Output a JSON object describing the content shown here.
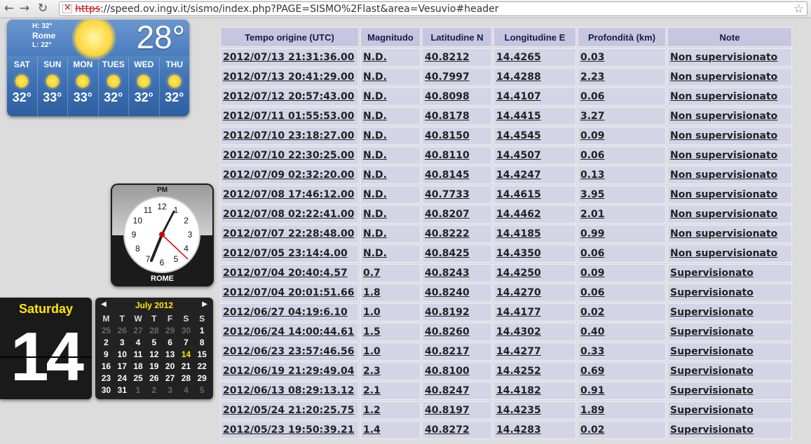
{
  "browser": {
    "url_scheme": "https",
    "url_rest": "://speed.ov.ingv.it/sismo/index.php?PAGE=SISMO%2Flast&area=Vesuvio#header"
  },
  "weather": {
    "hi": "H: 32°",
    "city": "Rome",
    "lo": "L: 22°",
    "current_temp": "28°",
    "days": [
      {
        "name": "SAT",
        "temp": "32°",
        "icon": "sun-icon"
      },
      {
        "name": "SUN",
        "temp": "33°",
        "icon": "sun-icon"
      },
      {
        "name": "MON",
        "temp": "33°",
        "icon": "sun-icon"
      },
      {
        "name": "TUES",
        "temp": "32°",
        "icon": "sun-icon"
      },
      {
        "name": "WED",
        "temp": "32°",
        "icon": "sun-icon"
      },
      {
        "name": "THU",
        "temp": "32°",
        "icon": "sun-icon"
      }
    ]
  },
  "clock": {
    "ampm": "PM",
    "city": "ROME",
    "numbers": [
      "12",
      "1",
      "2",
      "3",
      "4",
      "5",
      "6",
      "7",
      "8",
      "9",
      "10",
      "11"
    ]
  },
  "flip_calendar": {
    "weekday": "Saturday",
    "day": "14"
  },
  "month_calendar": {
    "title": "July 2012",
    "weekdays": [
      "M",
      "T",
      "W",
      "T",
      "F",
      "S",
      "S"
    ],
    "weeks": [
      [
        [
          "25",
          "dim"
        ],
        [
          "26",
          "dim"
        ],
        [
          "27",
          "dim"
        ],
        [
          "28",
          "dim"
        ],
        [
          "29",
          "dim"
        ],
        [
          "30",
          "dim"
        ],
        [
          "1",
          ""
        ]
      ],
      [
        [
          "2",
          ""
        ],
        [
          "3",
          ""
        ],
        [
          "4",
          ""
        ],
        [
          "5",
          ""
        ],
        [
          "6",
          ""
        ],
        [
          "7",
          ""
        ],
        [
          "8",
          ""
        ]
      ],
      [
        [
          "9",
          ""
        ],
        [
          "10",
          ""
        ],
        [
          "11",
          ""
        ],
        [
          "12",
          ""
        ],
        [
          "13",
          ""
        ],
        [
          "14",
          "today"
        ],
        [
          "15",
          ""
        ]
      ],
      [
        [
          "16",
          ""
        ],
        [
          "17",
          ""
        ],
        [
          "18",
          ""
        ],
        [
          "19",
          ""
        ],
        [
          "20",
          ""
        ],
        [
          "21",
          ""
        ],
        [
          "22",
          ""
        ]
      ],
      [
        [
          "23",
          ""
        ],
        [
          "24",
          ""
        ],
        [
          "25",
          ""
        ],
        [
          "26",
          ""
        ],
        [
          "27",
          ""
        ],
        [
          "28",
          ""
        ],
        [
          "29",
          ""
        ]
      ],
      [
        [
          "30",
          ""
        ],
        [
          "31",
          ""
        ],
        [
          "1",
          "dim"
        ],
        [
          "2",
          "dim"
        ],
        [
          "3",
          "dim"
        ],
        [
          "4",
          "dim"
        ],
        [
          "5",
          "dim"
        ]
      ]
    ]
  },
  "table": {
    "headers": [
      "Tempo origine (UTC)",
      "Magnitudo",
      "Latitudine N",
      "Longitudine E",
      "Profondità (km)",
      "Note"
    ],
    "rows": [
      [
        "2012/07/13 21:31:36.00",
        "N.D.",
        "40.8212",
        "14.4265",
        "0.03",
        "Non supervisionato"
      ],
      [
        "2012/07/13 20:41:29.00",
        "N.D.",
        "40.7997",
        "14.4288",
        "2.23",
        "Non supervisionato"
      ],
      [
        "2012/07/12 20:57:43.00",
        "N.D.",
        "40.8098",
        "14.4107",
        "0.06",
        "Non supervisionato"
      ],
      [
        "2012/07/11 01:55:53.00",
        "N.D.",
        "40.8178",
        "14.4415",
        "3.27",
        "Non supervisionato"
      ],
      [
        "2012/07/10 23:18:27.00",
        "N.D.",
        "40.8150",
        "14.4545",
        "0.09",
        "Non supervisionato"
      ],
      [
        "2012/07/10 22:30:25.00",
        "N.D.",
        "40.8110",
        "14.4507",
        "0.06",
        "Non supervisionato"
      ],
      [
        "2012/07/09 02:32:20.00",
        "N.D.",
        "40.8145",
        "14.4247",
        "0.13",
        "Non supervisionato"
      ],
      [
        "2012/07/08 17:46:12.00",
        "N.D.",
        "40.7733",
        "14.4615",
        "3.95",
        "Non supervisionato"
      ],
      [
        "2012/07/08 02:22:41.00",
        "N.D.",
        "40.8207",
        "14.4462",
        "2.01",
        "Non supervisionato"
      ],
      [
        "2012/07/07 22:28:48.00",
        "N.D.",
        "40.8222",
        "14.4185",
        "0.99",
        "Non supervisionato"
      ],
      [
        "2012/07/05 23:14:4.00",
        "N.D.",
        "40.8425",
        "14.4350",
        "0.06",
        "Non supervisionato"
      ],
      [
        "2012/07/04 20:40:4.57",
        "0.7",
        "40.8243",
        "14.4250",
        "0.09",
        "Supervisionato"
      ],
      [
        "2012/07/04 20:01:51.66",
        "1.8",
        "40.8240",
        "14.4270",
        "0.06",
        "Supervisionato"
      ],
      [
        "2012/06/27 04:19:6.10",
        "1.0",
        "40.8192",
        "14.4177",
        "0.02",
        "Supervisionato"
      ],
      [
        "2012/06/24 14:00:44.61",
        "1.5",
        "40.8260",
        "14.4302",
        "0.40",
        "Supervisionato"
      ],
      [
        "2012/06/23 23:57:46.56",
        "1.0",
        "40.8217",
        "14.4277",
        "0.33",
        "Supervisionato"
      ],
      [
        "2012/06/19 21:29:49.04",
        "2.3",
        "40.8100",
        "14.4252",
        "0.69",
        "Supervisionato"
      ],
      [
        "2012/06/13 08:29:13.12",
        "2.1",
        "40.8247",
        "14.4182",
        "0.91",
        "Supervisionato"
      ],
      [
        "2012/05/24 21:20:25.75",
        "1.2",
        "40.8197",
        "14.4235",
        "1.89",
        "Supervisionato"
      ],
      [
        "2012/05/23 19:50:39.21",
        "1.4",
        "40.8272",
        "14.4283",
        "0.02",
        "Supervisionato"
      ]
    ]
  }
}
